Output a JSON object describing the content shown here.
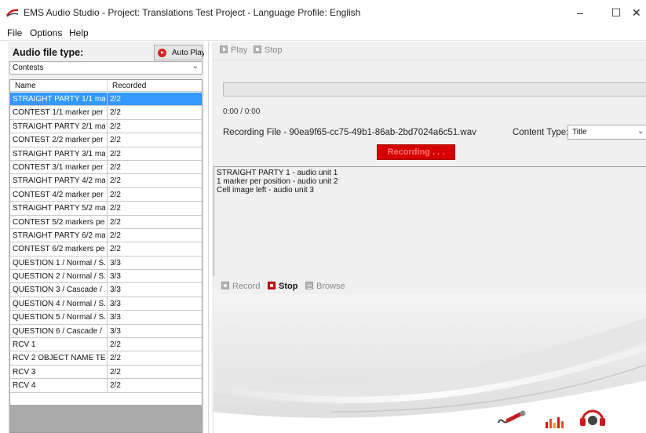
{
  "window": {
    "title": "EMS Audio Studio - Project: Translations Test Project - Language Profile: English",
    "minimize": "–",
    "maximize": "☐",
    "close": "✕"
  },
  "menu": [
    "File",
    "Options",
    "Help"
  ],
  "left_panel": {
    "audio_file_type_label": "Audio file type:",
    "auto_play_label": "Auto Play",
    "type_selected": "Contests",
    "columns": [
      "Name",
      "Recorded"
    ],
    "rows": [
      {
        "name": "STRAIGHT PARTY 1/1 ma...",
        "recorded": "2/2",
        "selected": true
      },
      {
        "name": "CONTEST 1/1 marker per ...",
        "recorded": "2/2"
      },
      {
        "name": "STRAIGHT PARTY 2/1 ma...",
        "recorded": "2/2"
      },
      {
        "name": "CONTEST 2/2 marker per ...",
        "recorded": "2/2"
      },
      {
        "name": "STRAIGHT PARTY 3/1 ma...",
        "recorded": "2/2"
      },
      {
        "name": "CONTEST 3/1 marker per ...",
        "recorded": "2/2"
      },
      {
        "name": "STRAIGHT PARTY 4/2 ma...",
        "recorded": "2/2"
      },
      {
        "name": "CONTEST 4/2 marker per ...",
        "recorded": "2/2"
      },
      {
        "name": "STRAIGHT PARTY 5/2 ma...",
        "recorded": "2/2"
      },
      {
        "name": "CONTEST 5/2 markers per ...",
        "recorded": "2/2"
      },
      {
        "name": "STRAIGHT PARTY 6/2 ma...",
        "recorded": "2/2"
      },
      {
        "name": "CONTEST 6/2 markers per ...",
        "recorded": "2/2"
      },
      {
        "name": "QUESTION 1 / Normal / S...",
        "recorded": "3/3"
      },
      {
        "name": "QUESTION 2 / Normal / S...",
        "recorded": "3/3"
      },
      {
        "name": "QUESTION 3 / Cascade / ...",
        "recorded": "3/3"
      },
      {
        "name": "QUESTION 4 / Normal / S...",
        "recorded": "3/3"
      },
      {
        "name": "QUESTION 5 / Normal / S...",
        "recorded": "3/3"
      },
      {
        "name": "QUESTION 6 / Cascade / ...",
        "recorded": "3/3"
      },
      {
        "name": "RCV 1",
        "recorded": "2/2"
      },
      {
        "name": "RCV 2 OBJECT NAME TE...",
        "recorded": "2/2"
      },
      {
        "name": "RCV 3",
        "recorded": "2/2"
      },
      {
        "name": "RCV 4",
        "recorded": "2/2"
      }
    ]
  },
  "player": {
    "play_label": "Play",
    "stop_label": "Stop",
    "time": "0:00 / 0:00",
    "recording_file": "Recording File - 90ea9f65-cc75-49b1-86ab-2bd7024a6c51.wav",
    "content_type_label": "Content Type:",
    "content_type_value": "Title",
    "recording_status": "Recording . . ."
  },
  "script_lines": [
    "STRAIGHT PARTY 1 - audio unit 1",
    "1 marker per position - audio unit 2",
    "Cell image left - audio unit 3"
  ],
  "recorder": {
    "record_label": "Record",
    "stop_label": "Stop",
    "browse_label": "Browse"
  },
  "colors": {
    "selected_row": "#3399ff",
    "recording_bg": "#d40000",
    "accent_red": "#cc1111"
  }
}
